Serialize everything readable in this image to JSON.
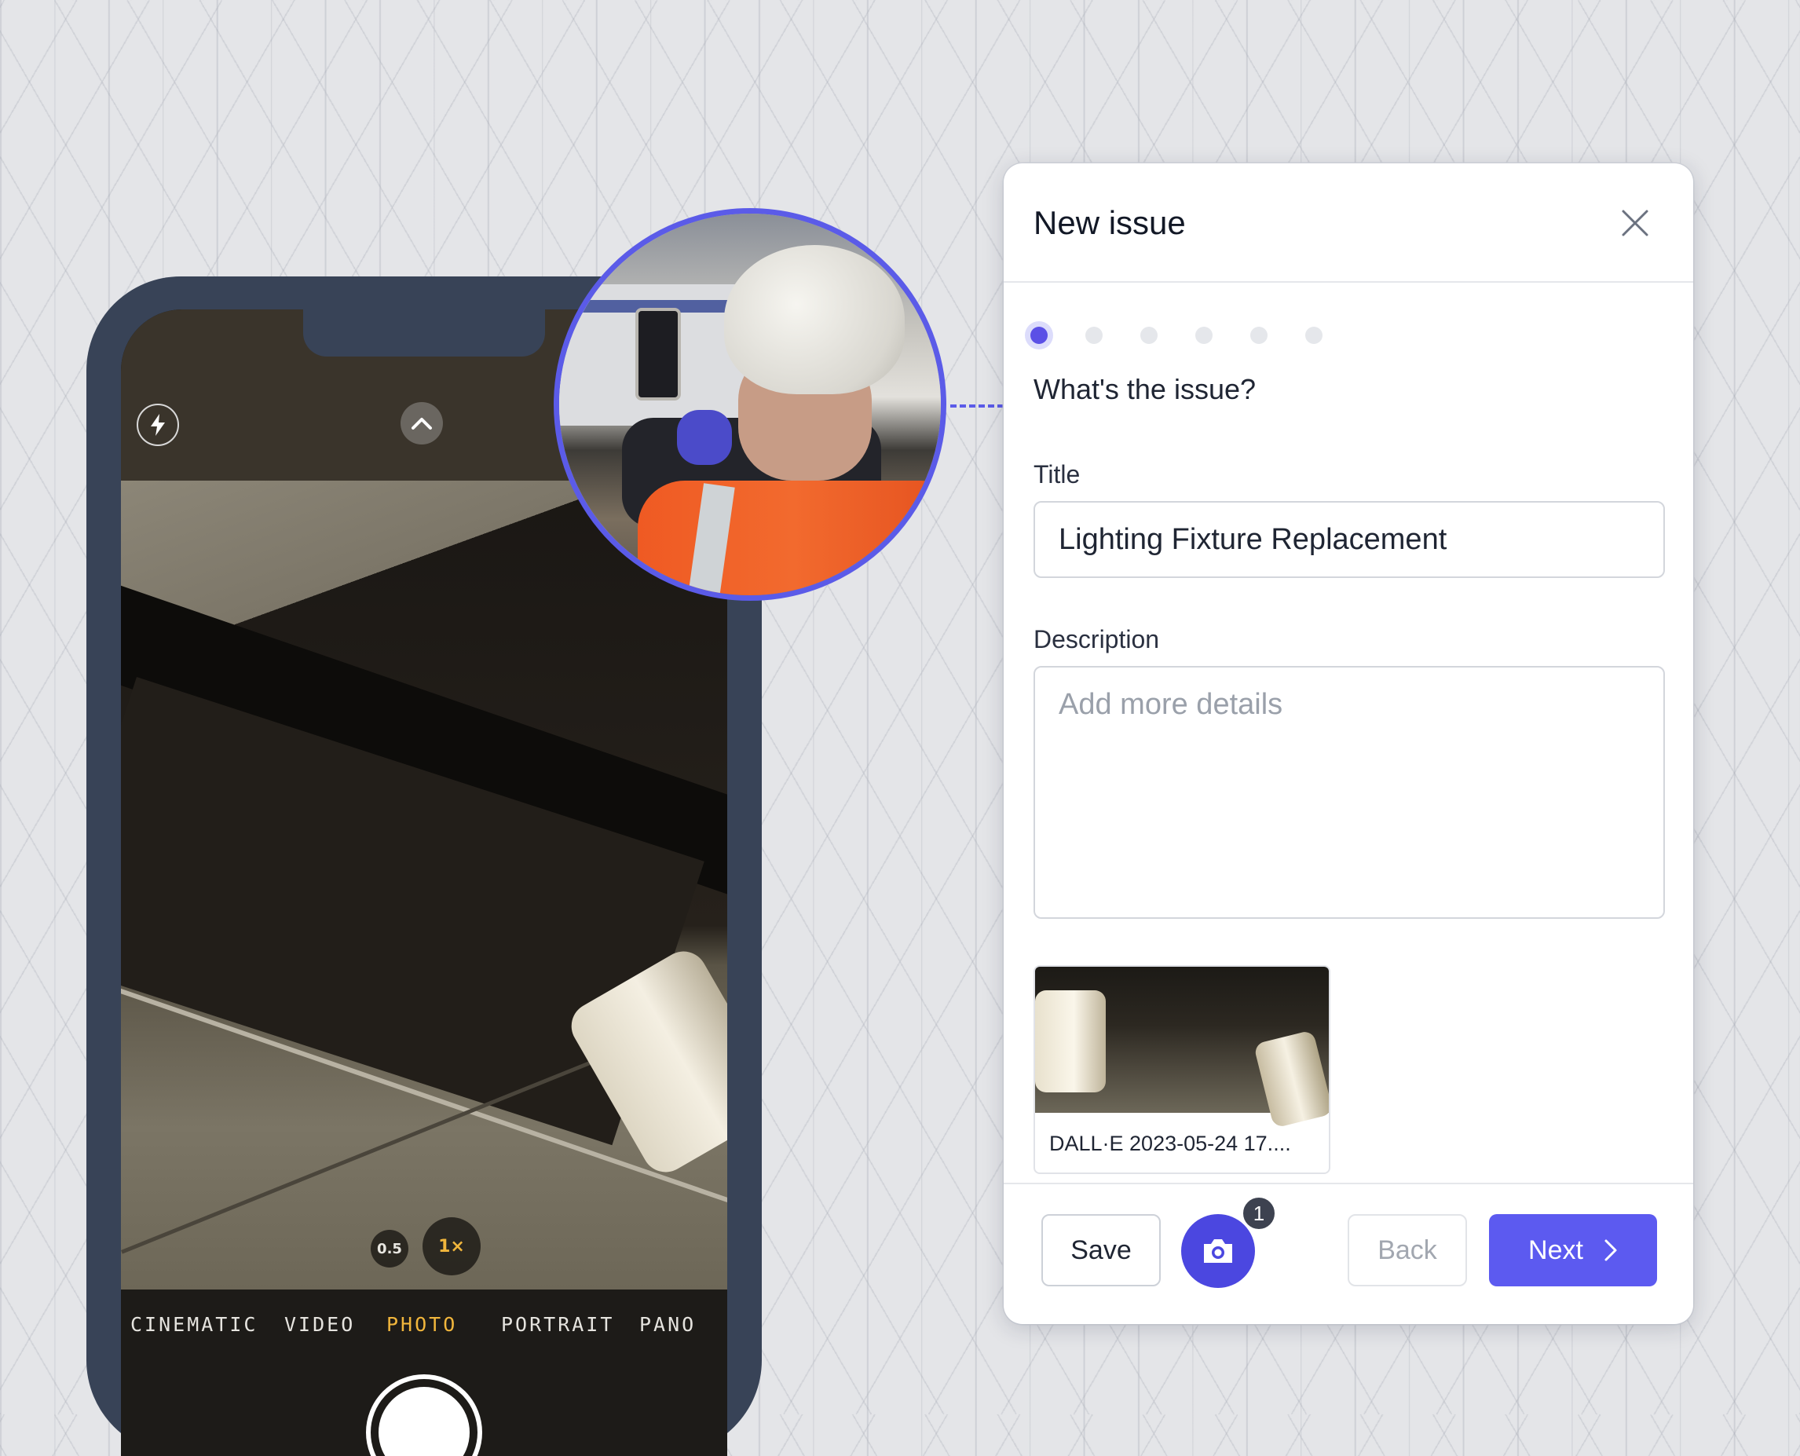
{
  "camera": {
    "zoom_options": [
      "0.5",
      "1×"
    ],
    "modes": [
      "CINEMATIC",
      "VIDEO",
      "PHOTO",
      "PORTRAIT",
      "PANO"
    ],
    "active_mode": "PHOTO",
    "icons": {
      "flash": "flash-icon",
      "expand": "chevron-up-icon"
    }
  },
  "dialog": {
    "title": "New issue",
    "step_total": 6,
    "step_current": 1,
    "question": "What's the issue?",
    "title_label": "Title",
    "title_value": "Lighting Fixture Replacement",
    "description_label": "Description",
    "description_placeholder": "Add more details",
    "attachment_name": "DALL·E 2023-05-24 17....",
    "footer": {
      "save": "Save",
      "photo_count": "1",
      "back": "Back",
      "next": "Next"
    }
  },
  "colors": {
    "accent": "#5c5af0",
    "camera_active": "#f1b63c",
    "phone_frame": "#384357"
  }
}
